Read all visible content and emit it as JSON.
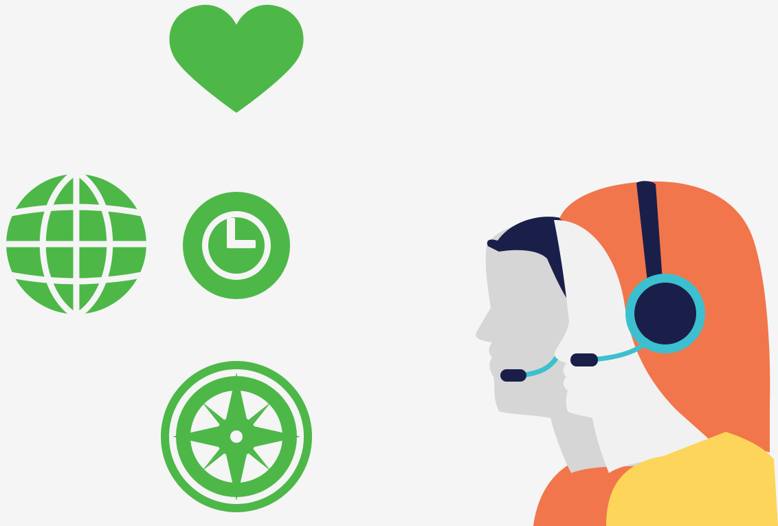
{
  "scene": {
    "background_color": "#f5f5f5",
    "icons": {
      "heart": "heart-icon",
      "globe": "globe-icon",
      "clock": "clock-icon",
      "compass": "compass-icon"
    },
    "illustration": "customer-support-agents-with-headsets"
  },
  "colors": {
    "icon_green": "#4db848",
    "hair_orange": "#f2764b",
    "hair_navy": "#1a1f4a",
    "headset_teal": "#3cc0cf",
    "face_gray": "#d6d6d6",
    "face_light": "#f1f1f1",
    "shirt_yellow": "#fcd55a"
  }
}
